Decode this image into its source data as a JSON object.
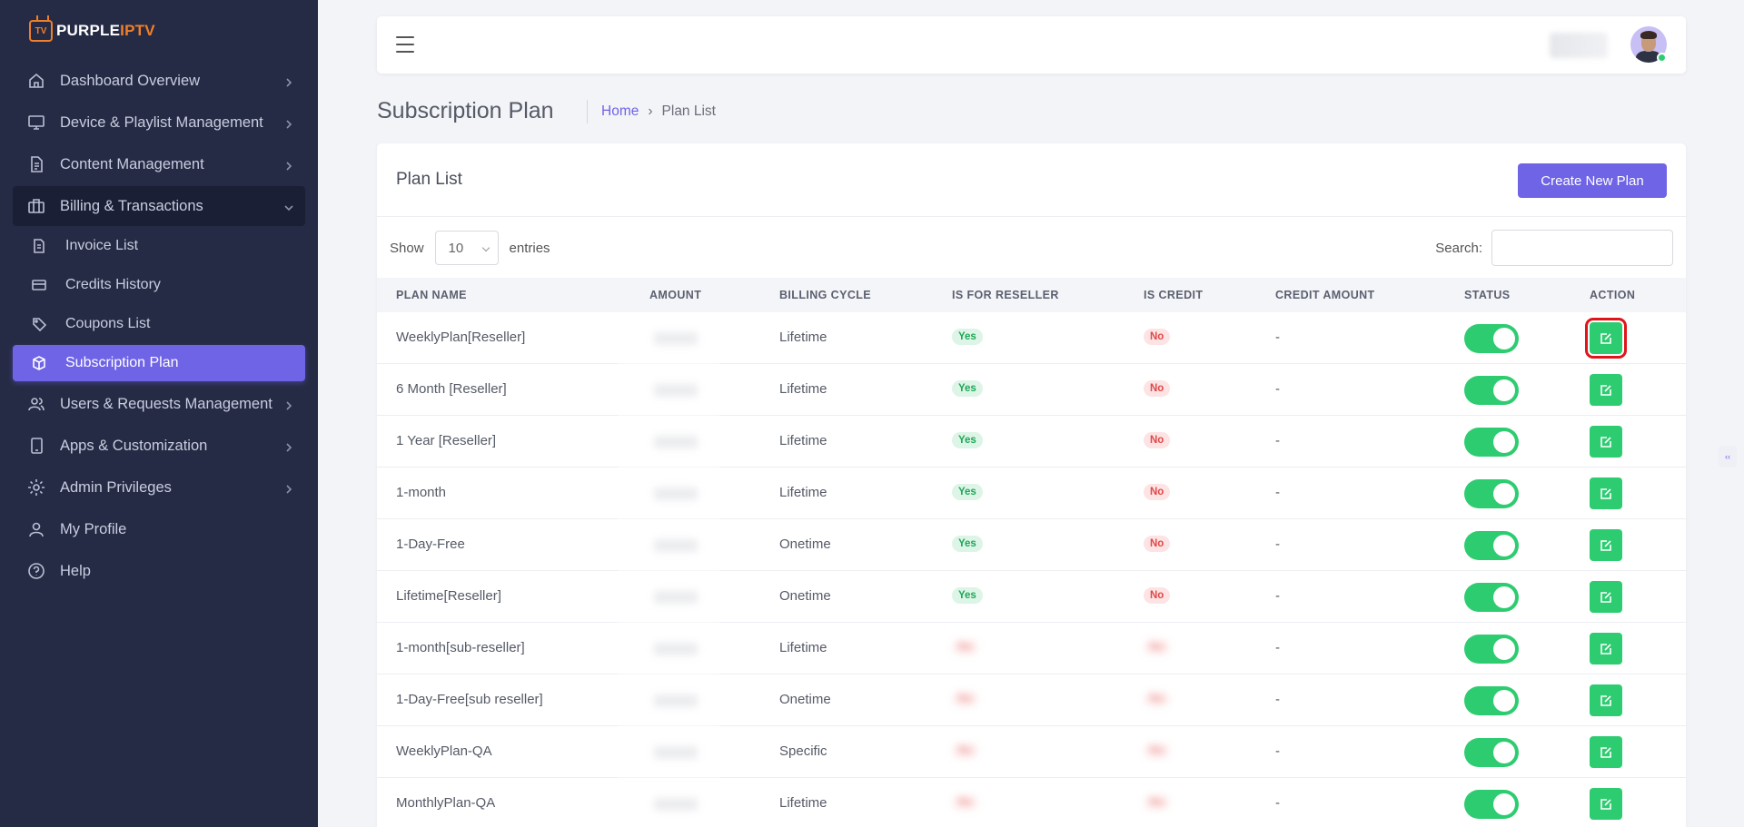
{
  "brand": {
    "part1": "PURPLE",
    "part2": "IPTV",
    "tv": "TV"
  },
  "sidebar": {
    "items": [
      {
        "label": "Dashboard Overview",
        "icon": "home-icon"
      },
      {
        "label": "Device & Playlist Management",
        "icon": "monitor-icon"
      },
      {
        "label": "Content Management",
        "icon": "document-icon"
      },
      {
        "label": "Billing & Transactions",
        "icon": "briefcase-icon"
      },
      {
        "label": "Users & Requests Management",
        "icon": "users-icon"
      },
      {
        "label": "Apps & Customization",
        "icon": "tablet-icon"
      },
      {
        "label": "Admin Privileges",
        "icon": "gear-icon"
      },
      {
        "label": "My Profile",
        "icon": "user-icon"
      },
      {
        "label": "Help",
        "icon": "help-icon"
      }
    ],
    "billing_sub": [
      {
        "label": "Invoice List",
        "icon": "invoice-icon"
      },
      {
        "label": "Credits History",
        "icon": "card-icon"
      },
      {
        "label": "Coupons List",
        "icon": "tag-icon"
      },
      {
        "label": "Subscription Plan",
        "icon": "box-icon"
      }
    ]
  },
  "page": {
    "title": "Subscription Plan",
    "breadcrumb": {
      "home": "Home",
      "sep": "›",
      "current": "Plan List"
    }
  },
  "card": {
    "title": "Plan List",
    "create_button": "Create New Plan",
    "show_label": "Show",
    "entries_value": "10",
    "entries_label": "entries",
    "search_label": "Search:"
  },
  "table": {
    "headers": [
      "PLAN NAME",
      "AMOUNT",
      "BILLING CYCLE",
      "IS FOR RESELLER",
      "IS CREDIT",
      "CREDIT AMOUNT",
      "STATUS",
      "ACTION"
    ],
    "rows": [
      {
        "name": "WeeklyPlan[Reseller]",
        "cycle": "Lifetime",
        "reseller": "Yes",
        "credit": "No",
        "credit_amount": "-",
        "status": true,
        "blurred_badges": false
      },
      {
        "name": "6 Month [Reseller]",
        "cycle": "Lifetime",
        "reseller": "Yes",
        "credit": "No",
        "credit_amount": "-",
        "status": true,
        "blurred_badges": false
      },
      {
        "name": "1 Year [Reseller]",
        "cycle": "Lifetime",
        "reseller": "Yes",
        "credit": "No",
        "credit_amount": "-",
        "status": true,
        "blurred_badges": false
      },
      {
        "name": "1-month",
        "cycle": "Lifetime",
        "reseller": "Yes",
        "credit": "No",
        "credit_amount": "-",
        "status": true,
        "blurred_badges": false
      },
      {
        "name": "1-Day-Free",
        "cycle": "Onetime",
        "reseller": "Yes",
        "credit": "No",
        "credit_amount": "-",
        "status": true,
        "blurred_badges": false
      },
      {
        "name": "Lifetime[Reseller]",
        "cycle": "Onetime",
        "reseller": "Yes",
        "credit": "No",
        "credit_amount": "-",
        "status": true,
        "blurred_badges": false
      },
      {
        "name": "1-month[sub-reseller]",
        "cycle": "Lifetime",
        "reseller": "No",
        "credit": "No",
        "credit_amount": "-",
        "status": true,
        "blurred_badges": true
      },
      {
        "name": "1-Day-Free[sub reseller]",
        "cycle": "Onetime",
        "reseller": "No",
        "credit": "No",
        "credit_amount": "-",
        "status": true,
        "blurred_badges": true
      },
      {
        "name": "WeeklyPlan-QA",
        "cycle": "Specific",
        "reseller": "No",
        "credit": "No",
        "credit_amount": "-",
        "status": true,
        "blurred_badges": true
      },
      {
        "name": "MonthlyPlan-QA",
        "cycle": "Lifetime",
        "reseller": "No",
        "credit": "No",
        "credit_amount": "-",
        "status": true,
        "blurred_badges": true
      }
    ]
  },
  "colors": {
    "sidebar_bg": "#262b45",
    "accent": "#6f63e6",
    "success": "#2ecc71",
    "danger": "#e04848",
    "highlight": "#e0151b"
  }
}
